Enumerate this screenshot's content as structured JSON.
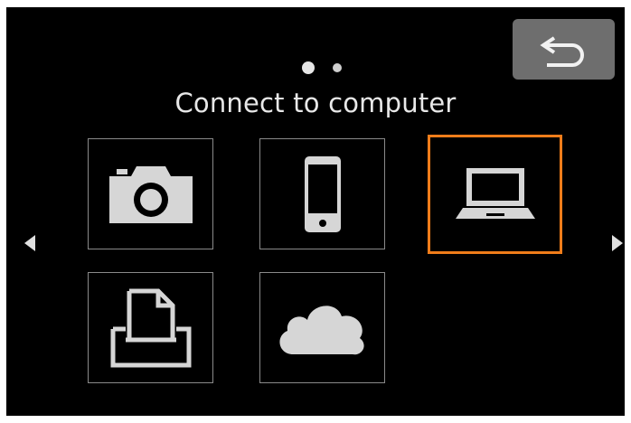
{
  "screen": {
    "title": "Connect to computer",
    "pagination": {
      "current_page": 1,
      "total_pages": 2
    }
  },
  "toolbar": {
    "back_icon": "return-arrow-icon"
  },
  "tiles": [
    {
      "id": "camera",
      "icon": "camera-icon",
      "selected": false
    },
    {
      "id": "smartphone",
      "icon": "smartphone-icon",
      "selected": false
    },
    {
      "id": "computer",
      "icon": "laptop-icon",
      "selected": true
    },
    {
      "id": "printer",
      "icon": "printer-icon",
      "selected": false
    },
    {
      "id": "web-service",
      "icon": "cloud-icon",
      "selected": false
    }
  ],
  "navigation": {
    "prev_icon": "left-arrow-icon",
    "next_icon": "right-arrow-icon"
  },
  "colors": {
    "background": "#000000",
    "tile_border": "#8a8a8a",
    "selected_border": "#f07d1a",
    "back_button": "#6e6e6e",
    "icon": "#e0e0e0",
    "text": "#e8e8e8"
  }
}
